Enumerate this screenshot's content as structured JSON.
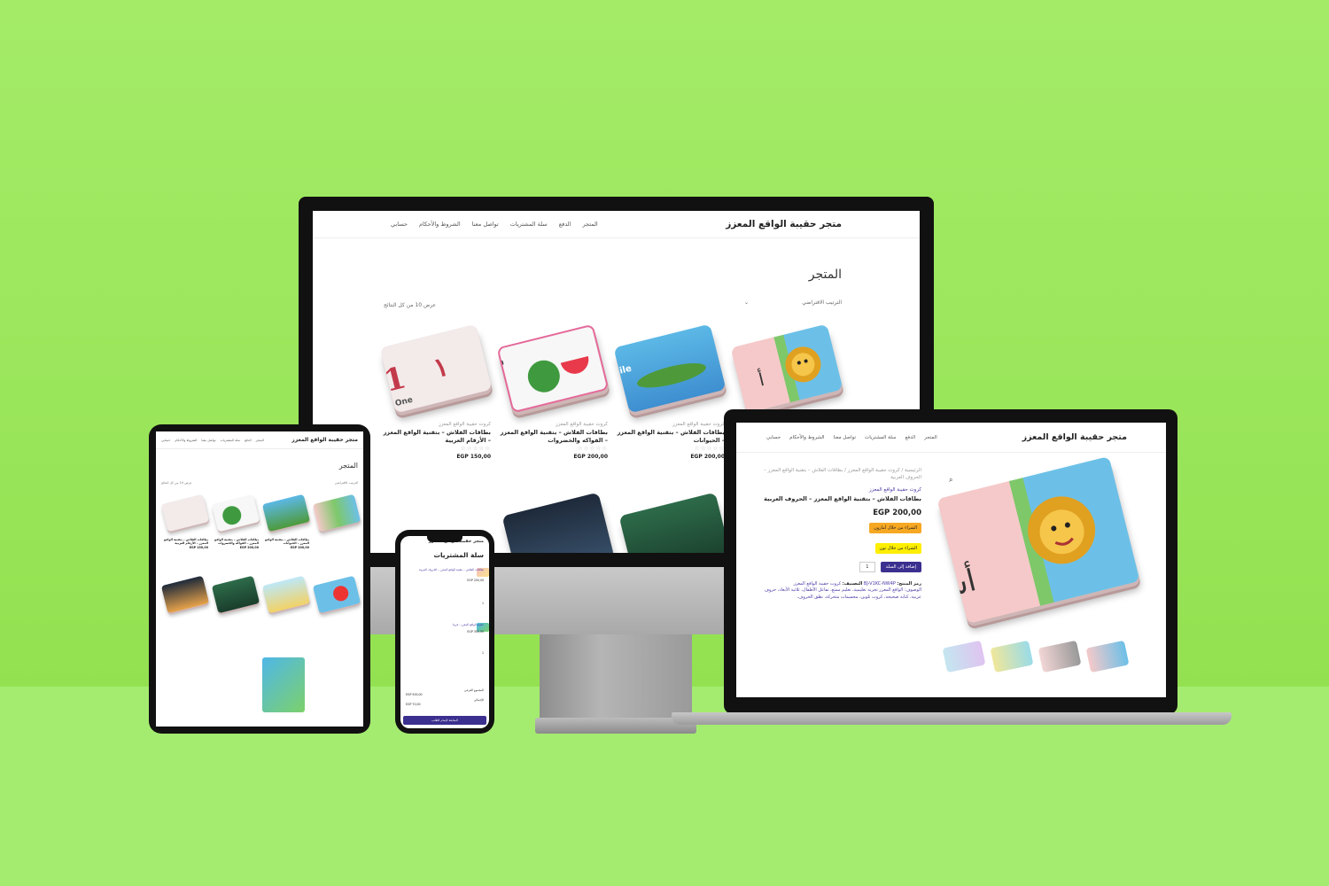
{
  "store": {
    "name": "متجر حقيبة الواقع المعزز",
    "menu": [
      "المتجر",
      "الدفع",
      "سلة المشتريات",
      "تواصل معنا",
      "الشروط والأحكام",
      "حسابي"
    ]
  },
  "shop": {
    "title": "المتجر",
    "sort_label": "الترتيب الافتراضي",
    "result_count": "عرض 10 من كل النتائج",
    "products": [
      {
        "category": "",
        "name": "",
        "price": "",
        "art": "lion"
      },
      {
        "category": "كروت حقيبة الواقع المعزز",
        "name": "بطاقات الفلاش – بتقنية الواقع المعزز – الحيوانات",
        "price": "200,00 EGP",
        "art": "crocodile"
      },
      {
        "category": "كروت حقيبة الواقع المعزز",
        "name": "بطاقات الفلاش – بتقنية الواقع المعزز – الفواكه والخضروات",
        "price": "200,00 EGP",
        "art": "watermelon"
      },
      {
        "category": "كروت حقيبة الواقع المعزز",
        "name": "بطاقات الفلاش – بتقنية الواقع المعزز – الأرقام العربية",
        "price": "150,00 EGP",
        "art": "one"
      }
    ]
  },
  "product_page": {
    "breadcrumb": "الرئيسية / كروت حقيبة الواقع المعزز / بطاقات الفلاش – بتقنية الواقع المعزز – الحروف العربية",
    "category": "كروت حقيبة الواقع المعزز",
    "title": "بطاقات الفلاش – بتقنية الواقع المعزز – الحروف العربية",
    "price": "200,00 EGP",
    "amazon_button": "الشراء من خلال أمازون",
    "noon_button": "الشراء من خلال نون",
    "quantity": "1",
    "add_to_cart": "إضافة إلى السلة",
    "sku_label": "رمز المنتج:",
    "sku": "BJ-V1KC-NW4P",
    "category_label": "التصنيف:",
    "category_value": "كروت حقيبة الواقع المعزز",
    "description": "الوصوف: الواقع المعزز تجربة تعليمية، تعليم ممتع، تفاعل الأطفال، ثلاثية الأبعاد، حروف عربية، كتابة صحيحة، كروت تلوين، مجسمات متحركة، نطق الحروف."
  },
  "cart": {
    "title": "سلة المشتريات",
    "item1_name": "بطاقات الفلاش – بتقنية الواقع المعزز – الحروف العربية",
    "item1_price": "EGP 200,00",
    "item2_name": "حقيبة الواقع المعزز – قريبا",
    "item2_price": "EGP 300,00",
    "qty": "1",
    "subtotal_label": "المجموع الفرعي",
    "subtotal": "EGP 500,00",
    "total_label": "الإجمالي",
    "total": "EGP 70,00",
    "checkout": "المتابعة لإتمام الطلب"
  },
  "colors": {
    "background": "#9fe862",
    "accent": "#3b2f8f",
    "amazon": "#f7a823",
    "noon": "#feee00"
  }
}
